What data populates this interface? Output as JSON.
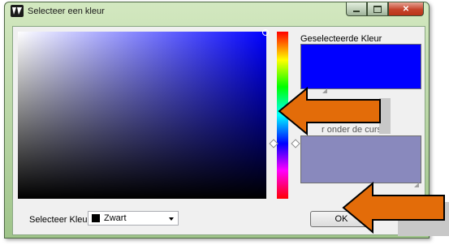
{
  "window": {
    "title": "Selecteer een kleur"
  },
  "picker": {
    "selected_label": "Geselecteerde Kleur",
    "selected_color": "#0000ff",
    "cursor_label": "r onder de cursor",
    "cursor_color": "#8989bd",
    "hue_position": 0.67
  },
  "footer": {
    "select_label": "Selecteer Kleur",
    "color_name": "Zwart",
    "color_swatch": "#000000",
    "ok_label": "OK"
  },
  "annotations": {
    "arrow_color": "#e36c09"
  }
}
